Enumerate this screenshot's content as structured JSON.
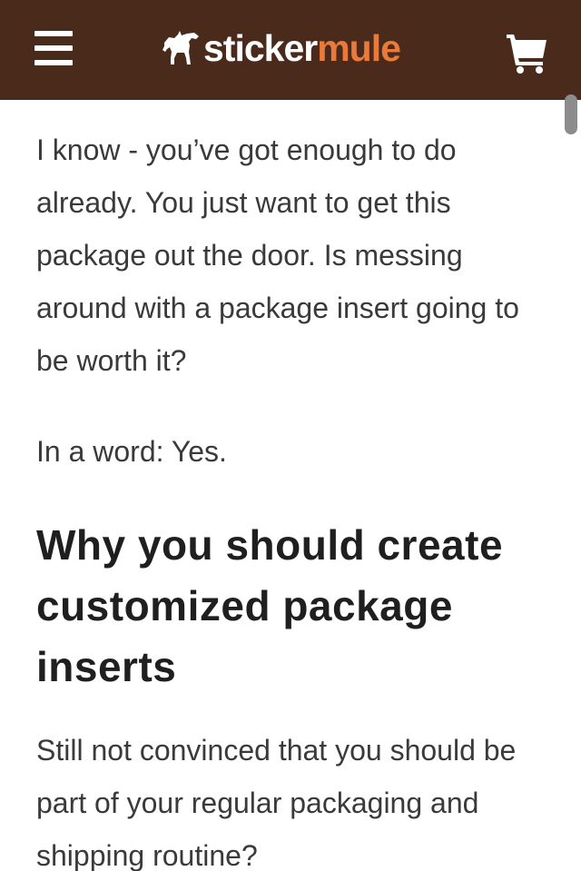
{
  "header": {
    "logo": {
      "part1": "sticker",
      "part2": "mule",
      "icon": "mule-icon"
    },
    "menu_icon": "hamburger-menu-icon",
    "cart_icon": "cart-icon",
    "colors": {
      "background": "#4a2a1a",
      "logo_primary": "#ffffff",
      "logo_accent": "#e87a3b"
    }
  },
  "article": {
    "paragraph_1": "I know - you’ve got enough to do already. You just want to get this package out the door. Is messing around with a package insert going to be worth it?",
    "paragraph_2": "In a word: Yes.",
    "heading": "Why you should create customized package inserts",
    "paragraph_3": "Still not convinced that you should be part of your regular packaging and shipping routine?"
  }
}
